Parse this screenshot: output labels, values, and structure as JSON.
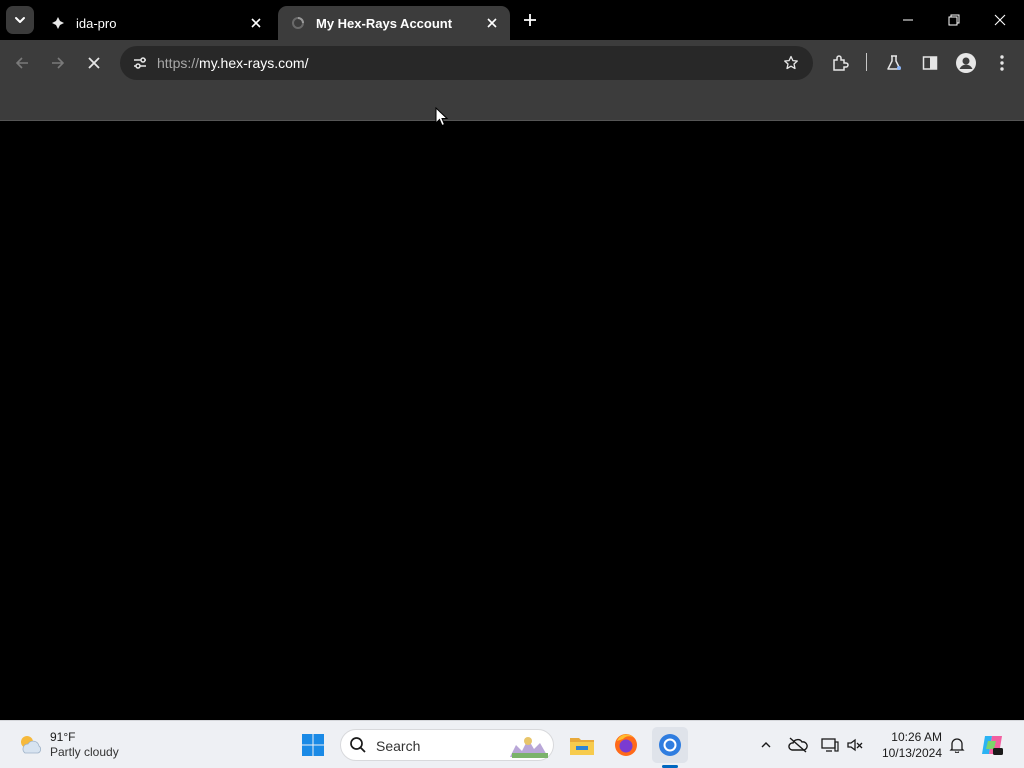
{
  "browser": {
    "tabs": [
      {
        "title": "ida-pro",
        "active": false,
        "icon": "hexrays-favicon-icon"
      },
      {
        "title": "My Hex-Rays Account",
        "active": true,
        "icon": "loading-favicon-icon"
      }
    ],
    "address": {
      "scheme": "https://",
      "host": "my.hex-rays.com/"
    },
    "loading": true
  },
  "taskbar": {
    "weather": {
      "temp": "91°F",
      "condition": "Partly cloudy"
    },
    "search_label": "Search",
    "clock": {
      "time": "10:26 AM",
      "date": "10/13/2024"
    },
    "pinned": [
      "start-icon",
      "file-explorer-icon",
      "firefox-icon",
      "chrome-icon"
    ]
  },
  "colors": {
    "tab_active": "#3c3c3c",
    "omnibox": "#282828",
    "taskbar": "#eef0f4",
    "accent": "#0067c0"
  }
}
